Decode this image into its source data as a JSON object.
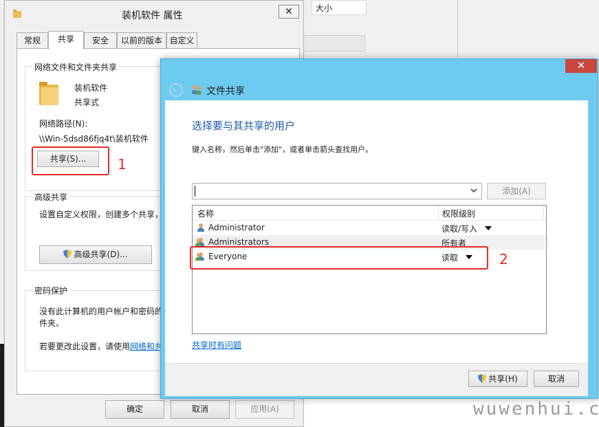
{
  "background_window": {
    "column_header": "大小"
  },
  "properties_dialog": {
    "title": "装机软件 属性",
    "close_glyph": "✕",
    "tabs": [
      {
        "label": "常规"
      },
      {
        "label": "共享"
      },
      {
        "label": "安全"
      },
      {
        "label": "以前的版本"
      },
      {
        "label": "自定义"
      }
    ],
    "network_group": {
      "title": "网络文件和文件夹共享",
      "folder_name": "装机软件",
      "share_state": "共享式",
      "path_label": "网络路径(N):",
      "path_value": "\\\\Win-5dsd86fjq4t\\装机软件",
      "share_button": "共享(S)...",
      "annotation_number": "1"
    },
    "advanced_group": {
      "title": "高级共享",
      "description": "设置自定义权限，创建多个共享，并",
      "button": "高级共享(D)..."
    },
    "password_group": {
      "title": "密码保护",
      "line1": "没有此计算机的用户帐户和密码的用",
      "line2": "件夹。",
      "line3_prefix": "若要更改此设置，请使用",
      "line3_link": "网络和共"
    },
    "buttons": {
      "ok": "确定",
      "cancel": "取消",
      "apply": "应用(A)"
    }
  },
  "share_dialog": {
    "title": "文件共享",
    "close_glyph": "✕",
    "back_glyph": "←",
    "heading": "选择要与其共享的用户",
    "instruction": "键入名称，然后单击\"添加\"，或者单击箭头查找用户。",
    "input_value": "",
    "add_button": "添加(A)",
    "columns": [
      "名称",
      "权限级别"
    ],
    "rows": [
      {
        "name": "Administrator",
        "permission": "读取/写入",
        "has_dropdown": true,
        "icon": "user-icon"
      },
      {
        "name": "Administrators",
        "permission": "所有者",
        "has_dropdown": false,
        "icon": "group-icon"
      },
      {
        "name": "Everyone",
        "permission": "读取",
        "has_dropdown": true,
        "icon": "group-icon"
      }
    ],
    "help_link": "共享时有问题",
    "share_button": "共享(H)",
    "cancel_button": "取消",
    "annotation_number": "2"
  },
  "watermark": "wuwenhui.cn",
  "colors": {
    "titlebar_accent": "#6ecbf0",
    "heading_blue": "#1c5aa6",
    "annotation_red": "#e52a2a",
    "close_red": "#c9463d"
  }
}
